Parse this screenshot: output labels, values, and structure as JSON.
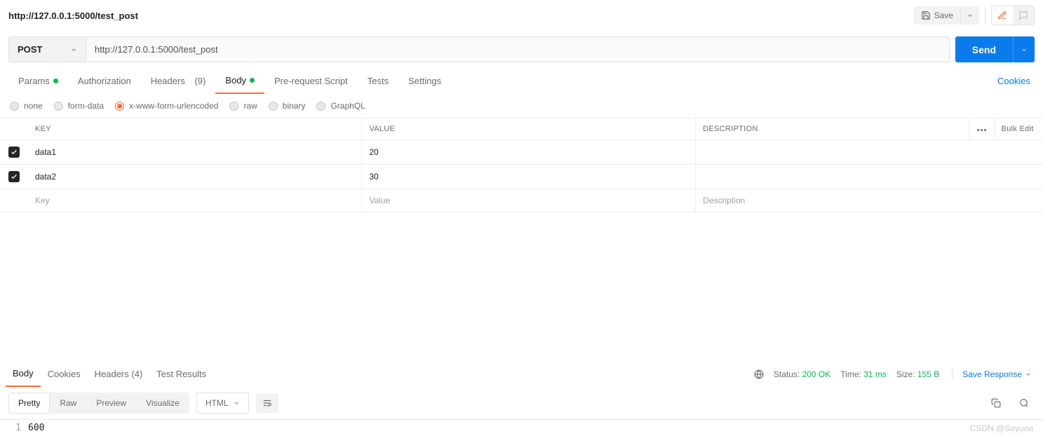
{
  "topbar": {
    "title": "http://127.0.0.1:5000/test_post",
    "save_label": "Save"
  },
  "request": {
    "method": "POST",
    "url": "http://127.0.0.1:5000/test_post",
    "send_label": "Send"
  },
  "reqTabs": {
    "params": "Params",
    "authorization": "Authorization",
    "headers_label": "Headers",
    "headers_count": "(9)",
    "body": "Body",
    "prerequest": "Pre-request Script",
    "tests": "Tests",
    "settings": "Settings",
    "cookies": "Cookies"
  },
  "bodyTypes": {
    "none": "none",
    "formdata": "form-data",
    "xwww": "x-www-form-urlencoded",
    "raw": "raw",
    "binary": "binary",
    "graphql": "GraphQL"
  },
  "kv": {
    "headers": {
      "key": "KEY",
      "value": "VALUE",
      "description": "DESCRIPTION"
    },
    "rows": [
      {
        "checked": true,
        "key": "data1",
        "value": "20",
        "description": ""
      },
      {
        "checked": true,
        "key": "data2",
        "value": "30",
        "description": ""
      }
    ],
    "placeholders": {
      "key": "Key",
      "value": "Value",
      "description": "Description"
    },
    "bulk_edit": "Bulk Edit"
  },
  "respTabs": {
    "body": "Body",
    "cookies": "Cookies",
    "headers_label": "Headers",
    "headers_count": "(4)",
    "test_results": "Test Results"
  },
  "respMeta": {
    "status_label": "Status:",
    "status_value": "200 OK",
    "time_label": "Time:",
    "time_value": "31 ms",
    "size_label": "Size:",
    "size_value": "155 B",
    "save_response": "Save Response"
  },
  "respToolbar": {
    "pretty": "Pretty",
    "raw": "Raw",
    "preview": "Preview",
    "visualize": "Visualize",
    "lang": "HTML"
  },
  "code": {
    "line1_no": "1",
    "line1_text": "600"
  },
  "watermark": "CSDN @Suyuoa"
}
